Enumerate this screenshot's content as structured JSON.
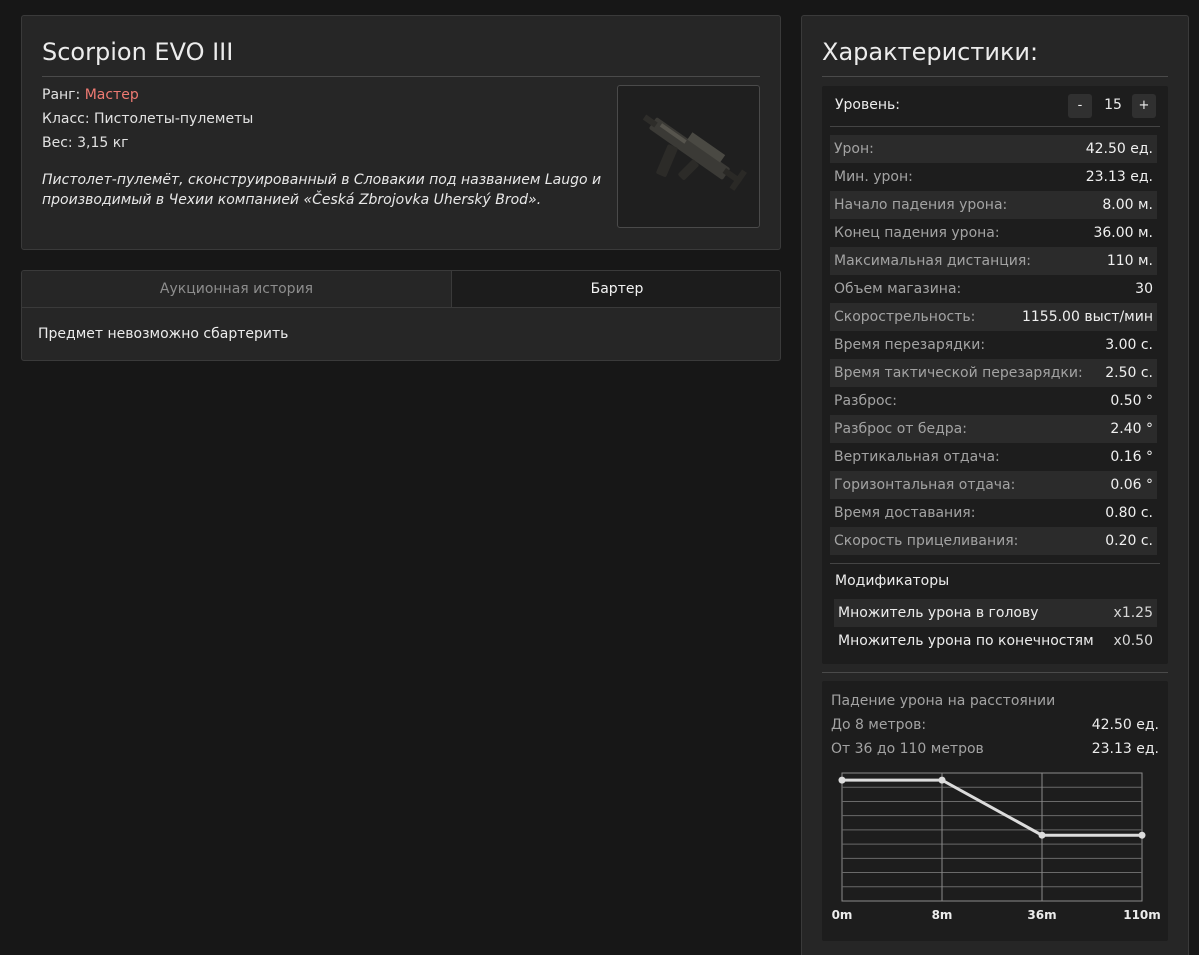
{
  "item": {
    "title": "Scorpion EVO III",
    "rank_label": "Ранг: ",
    "rank_value": "Мастер",
    "class_text": "Класс: Пистолеты-пулеметы",
    "weight_text": "Вес: 3,15 кг",
    "description": "Пистолет-пулемёт, сконструированный в Словакии под названием Laugo и производимый в Чехии компанией «Česká Zbrojovka Uherský Brod».",
    "image_icon": "smg-weapon-image"
  },
  "tabs": {
    "auction_label": "Аукционная история",
    "barter_label": "Бартер",
    "active": "barter",
    "barter_message": "Предмет невозможно сбартерить"
  },
  "stats": {
    "title": "Характеристики:",
    "level_label": "Уровень:",
    "level_minus": "-",
    "level_value": "15",
    "level_plus": "+",
    "rows": [
      {
        "label": "Урон:",
        "value": "42.50 ед."
      },
      {
        "label": "Мин. урон:",
        "value": "23.13 ед."
      },
      {
        "label": "Начало падения урона:",
        "value": "8.00 м."
      },
      {
        "label": "Конец падения урона:",
        "value": "36.00 м."
      },
      {
        "label": "Максимальная дистанция:",
        "value": "110 м."
      },
      {
        "label": "Объем магазина:",
        "value": "30"
      },
      {
        "label": "Скорострельность:",
        "value": "1155.00 выст/мин"
      },
      {
        "label": "Время перезарядки:",
        "value": "3.00 с."
      },
      {
        "label": "Время тактической перезарядки:",
        "value": "2.50 с."
      },
      {
        "label": "Разброс:",
        "value": "0.50 °"
      },
      {
        "label": "Разброс от бедра:",
        "value": "2.40 °"
      },
      {
        "label": "Вертикальная отдача:",
        "value": "0.16 °"
      },
      {
        "label": "Горизонтальная отдача:",
        "value": "0.06 °"
      },
      {
        "label": "Время доставания:",
        "value": "0.80 с."
      },
      {
        "label": "Скорость прицеливания:",
        "value": "0.20 с."
      }
    ],
    "modifiers_title": "Модификаторы",
    "modifiers": [
      {
        "label": "Множитель урона в голову",
        "value": "x1.25"
      },
      {
        "label": "Множитель урона по конечностям",
        "value": "x0.50"
      }
    ]
  },
  "falloff": {
    "title": "Падение урона на расстоянии",
    "rows": [
      {
        "label": "До 8 метров:",
        "value": "42.50 ед."
      },
      {
        "label": "От 36 до 110 метров",
        "value": "23.13 ед."
      }
    ]
  },
  "chart_data": {
    "type": "line",
    "title": "",
    "xlabel": "",
    "ylabel": "",
    "categories": [
      "0m",
      "8m",
      "36m",
      "110m"
    ],
    "values": [
      42.5,
      42.5,
      23.13,
      23.13
    ],
    "ylim": [
      0,
      45
    ],
    "grid": true,
    "line_color": "#dcdcdc"
  }
}
